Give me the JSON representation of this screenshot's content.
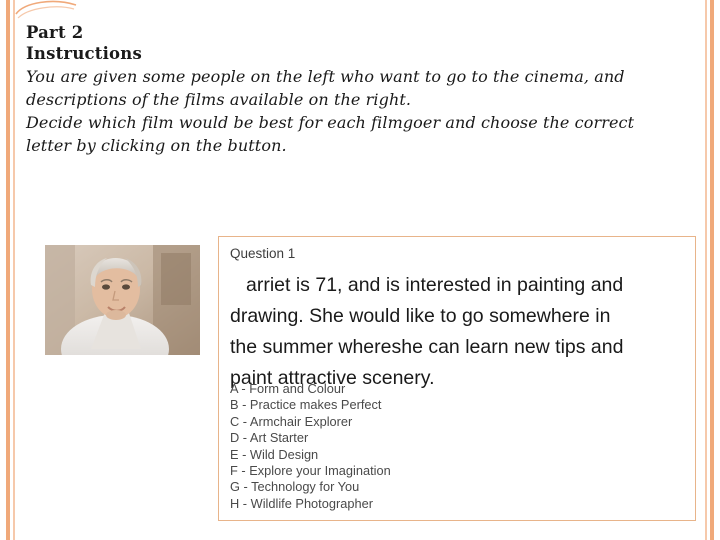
{
  "slide": {
    "title": "Part 2",
    "subtitle": "Instructions",
    "instructions_line1": "You are given some people on the left who want to go to the cinema, and",
    "instructions_line2": "descriptions of the films available on the right.",
    "instructions_line3": "Decide which film would be best for each filmgoer and choose the correct",
    "instructions_line4": "letter by clicking on the button.",
    "accent_color": "#f0a97a",
    "accent_light_color": "#f6c9ab",
    "box_border_color": "#e8b48a"
  },
  "question": {
    "label": "Question 1",
    "text_line1": "arriet is 71, and is interested in painting and",
    "text_line2": "drawing. She would like to go somewhere in",
    "text_line3": "the summer whereshe can learn new tips and",
    "text_line4": "paint attractive scenery.",
    "options": [
      "A - Form and Colour",
      "B - Practice makes Perfect",
      "C - Armchair Explorer",
      "D - Art Starter",
      "E - Wild Design",
      "F - Explore your Imagination",
      "G - Technology for You",
      "H - Wildlife Photographer"
    ]
  },
  "photo": {
    "alt": "portrait of an older woman with short light hair"
  }
}
